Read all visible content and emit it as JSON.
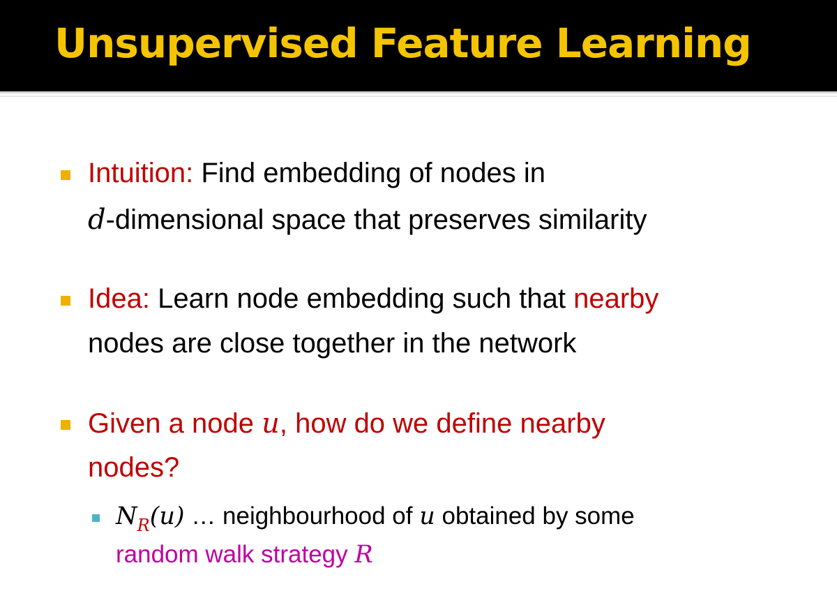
{
  "title": "Unsupervised Feature Learning",
  "bullets": [
    {
      "label": "Intuition:",
      "text1": "Find embedding of nodes in",
      "var": "d",
      "text2": "-dimensional space that preserves similarity"
    },
    {
      "label": "Idea:",
      "text1": "Learn node embedding such that",
      "highlight": "nearby",
      "text2": "nodes are close together in the network"
    },
    {
      "text1": "Given a node",
      "var": "u",
      "text2": ", how do we define nearby",
      "text3": "nodes?"
    }
  ],
  "sub_bullet": {
    "N": "N",
    "R_sub": "R",
    "paren_u": "(u)",
    "text1": " … neighbourhood of ",
    "var_u": "u",
    "text2": " obtained by some",
    "highlight": "random walk strategy ",
    "var_R": "R"
  },
  "colors": {
    "title": "#f5c400",
    "bullet": "#f0b000",
    "sub_bullet": "#4fb3c8",
    "red": "#c00000",
    "magenta": "#c000a0"
  }
}
